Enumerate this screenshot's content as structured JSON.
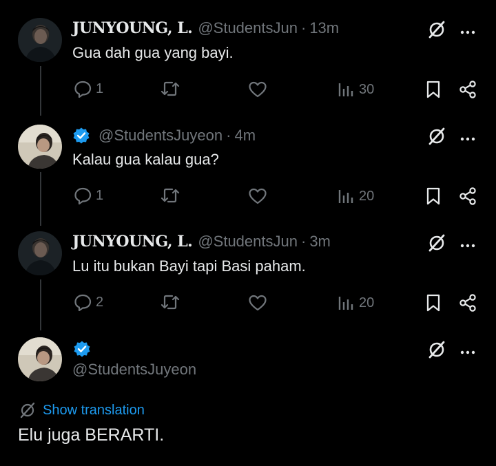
{
  "tweets": [
    {
      "display_name": "JUNYOUNG, L.",
      "handle": "@StudentsJun",
      "sep": "·",
      "time": "13m",
      "text": "Gua dah gua yang bayi.",
      "replies": "1",
      "views": "30"
    },
    {
      "handle": "@StudentsJuyeon",
      "sep": "·",
      "time": "4m",
      "text": "Kalau gua kalau gua?",
      "replies": "1",
      "views": "20"
    },
    {
      "display_name": "JUNYOUNG, L.",
      "handle": "@StudentsJun",
      "sep": "·",
      "time": "3m",
      "text": "Lu itu bukan Bayi tapi Basi paham.",
      "replies": "2",
      "views": "20"
    }
  ],
  "focused": {
    "handle": "@StudentsJuyeon",
    "translate_label": "Show translation",
    "text": "Elu juga BERARTI."
  },
  "colors": {
    "background": "#000000",
    "text": "#e7e9ea",
    "muted": "#71767b",
    "accent": "#1d9bf0"
  },
  "icons": [
    "reply-icon",
    "retweet-icon",
    "like-icon",
    "views-icon",
    "bookmark-icon",
    "share-icon",
    "grok-icon",
    "more-icon",
    "verified-badge-icon",
    "translate-icon"
  ]
}
